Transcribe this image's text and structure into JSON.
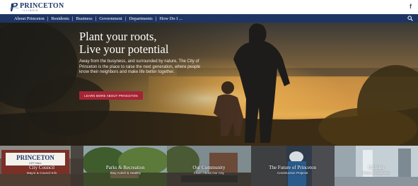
{
  "header": {
    "logo_text": "PRINCETON",
    "logo_subtext": "ILLINOIS",
    "social_icon": "facebook-icon",
    "social_glyph": "f"
  },
  "nav": {
    "items": [
      "About Princeton",
      "Residents",
      "Business",
      "Government",
      "Departments",
      "How Do I ..."
    ],
    "search_icon": "search-icon"
  },
  "hero": {
    "title_line1": "Plant your roots,",
    "title_line2": "Live your potential",
    "description": "Away from the busyness, and surrounded by nature, The City of Princeton is the place to raise the next generation, where people know their neighbors and make life better together.",
    "button_label": "LEARN MORE ABOUT PRINCETON",
    "button_color": "#a52434"
  },
  "tiles": [
    {
      "title": "City Council",
      "subtitle": "Mayor & Council Info",
      "sign_text": "PRINCETON",
      "sign_subtext": "CITY HALL"
    },
    {
      "title": "Parks & Recreation",
      "subtitle": "Stay Active & Healthy"
    },
    {
      "title": "Our Community",
      "subtitle": "Learn About Our City"
    },
    {
      "title": "The Future of Princeton",
      "subtitle": "Construction Projects"
    },
    {
      "title": "Utilities",
      "subtitle": "Water & Trash Info"
    }
  ],
  "colors": {
    "nav_background": "#1e3563",
    "logo_color": "#1d3766"
  }
}
